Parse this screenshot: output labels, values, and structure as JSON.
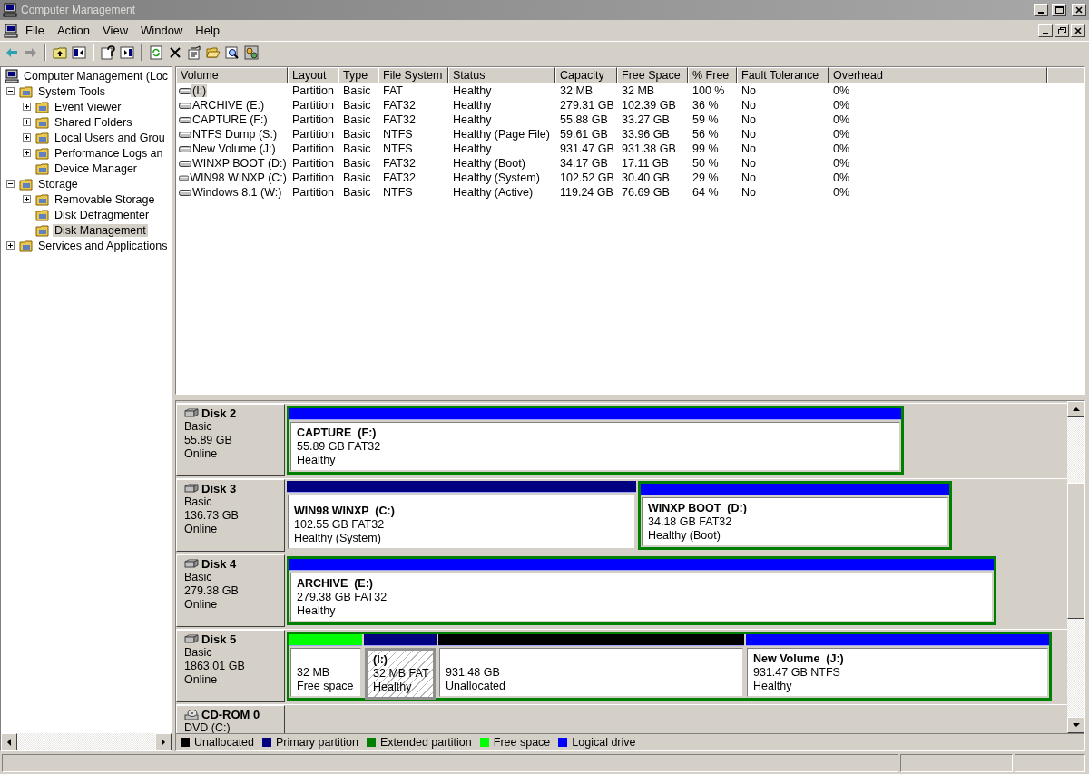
{
  "window": {
    "title": "Computer Management"
  },
  "menu": [
    "File",
    "Action",
    "View",
    "Window",
    "Help"
  ],
  "tree": [
    {
      "label": "Computer Management (Loc",
      "selected": false,
      "children": [
        {
          "label": "System Tools",
          "selected": false,
          "expanded": true,
          "children": [
            {
              "label": "Event Viewer",
              "selected": false,
              "expanded": false
            },
            {
              "label": "Shared Folders",
              "selected": false,
              "expanded": false
            },
            {
              "label": "Local Users and Grou",
              "selected": false,
              "expanded": false
            },
            {
              "label": "Performance Logs an",
              "selected": false,
              "expanded": false
            },
            {
              "label": "Device Manager",
              "selected": false
            }
          ]
        },
        {
          "label": "Storage",
          "selected": false,
          "expanded": true,
          "children": [
            {
              "label": "Removable Storage",
              "selected": false,
              "expanded": false
            },
            {
              "label": "Disk Defragmenter",
              "selected": false
            },
            {
              "label": "Disk Management",
              "selected": true
            }
          ]
        },
        {
          "label": "Services and Applications",
          "selected": false,
          "expanded": false
        }
      ]
    }
  ],
  "table": {
    "columns": [
      "Volume",
      "Layout",
      "Type",
      "File System",
      "Status",
      "Capacity",
      "Free Space",
      "% Free",
      "Fault Tolerance",
      "Overhead"
    ],
    "rows": [
      {
        "selected": true,
        "cells": [
          "(I:)",
          "Partition",
          "Basic",
          "FAT",
          "Healthy",
          "32 MB",
          "32 MB",
          "100 %",
          "No",
          "0%"
        ]
      },
      {
        "selected": false,
        "cells": [
          "ARCHIVE (E:)",
          "Partition",
          "Basic",
          "FAT32",
          "Healthy",
          "279.31 GB",
          "102.39 GB",
          "36 %",
          "No",
          "0%"
        ]
      },
      {
        "selected": false,
        "cells": [
          "CAPTURE (F:)",
          "Partition",
          "Basic",
          "FAT32",
          "Healthy",
          "55.88 GB",
          "33.27 GB",
          "59 %",
          "No",
          "0%"
        ]
      },
      {
        "selected": false,
        "cells": [
          "NTFS Dump (S:)",
          "Partition",
          "Basic",
          "NTFS",
          "Healthy (Page File)",
          "59.61 GB",
          "33.96 GB",
          "56 %",
          "No",
          "0%"
        ]
      },
      {
        "selected": false,
        "cells": [
          "New Volume (J:)",
          "Partition",
          "Basic",
          "NTFS",
          "Healthy",
          "931.47 GB",
          "931.38 GB",
          "99 %",
          "No",
          "0%"
        ]
      },
      {
        "selected": false,
        "cells": [
          "WINXP BOOT (D:)",
          "Partition",
          "Basic",
          "FAT32",
          "Healthy (Boot)",
          "34.17 GB",
          "17.11 GB",
          "50 %",
          "No",
          "0%"
        ]
      },
      {
        "selected": false,
        "cells": [
          "WIN98 WINXP (C:)",
          "Partition",
          "Basic",
          "FAT32",
          "Healthy (System)",
          "102.52 GB",
          "30.40 GB",
          "29 %",
          "No",
          "0%"
        ]
      },
      {
        "selected": false,
        "cells": [
          "Windows 8.1 (W:)",
          "Partition",
          "Basic",
          "NTFS",
          "Healthy (Active)",
          "119.24 GB",
          "76.69 GB",
          "64 %",
          "No",
          "0%"
        ]
      }
    ]
  },
  "disks": [
    {
      "kind": "disk",
      "name": "Disk 2",
      "type": "Basic",
      "size": "55.89 GB",
      "status": "Online",
      "partitions": [
        {
          "kind": "logical",
          "extended": true,
          "selected": false,
          "title": "CAPTURE  (F:)",
          "size": "55.89 GB FAT32",
          "status": "Healthy"
        }
      ]
    },
    {
      "kind": "disk",
      "name": "Disk 3",
      "type": "Basic",
      "size": "136.73 GB",
      "status": "Online",
      "partitions": [
        {
          "kind": "primary",
          "extended": false,
          "selected": false,
          "title": "WIN98 WINXP  (C:)",
          "size": "102.55 GB FAT32",
          "status": "Healthy (System)"
        },
        {
          "kind": "logical",
          "extended": true,
          "selected": false,
          "title": "WINXP BOOT  (D:)",
          "size": "34.18 GB FAT32",
          "status": "Healthy (Boot)"
        }
      ]
    },
    {
      "kind": "disk",
      "name": "Disk 4",
      "type": "Basic",
      "size": "279.38 GB",
      "status": "Online",
      "partitions": [
        {
          "kind": "logical",
          "extended": true,
          "selected": false,
          "title": "ARCHIVE  (E:)",
          "size": "279.38 GB FAT32",
          "status": "Healthy"
        }
      ]
    },
    {
      "kind": "disk",
      "name": "Disk 5",
      "type": "Basic",
      "size": "1863.01 GB",
      "status": "Online",
      "partitions": [
        {
          "kind": "free",
          "extended": true,
          "selected": false,
          "size": "32 MB",
          "status": "Free space"
        },
        {
          "kind": "primary",
          "extended": true,
          "selected": true,
          "title": "(I:)",
          "size": "32 MB FAT",
          "status": "Healthy"
        },
        {
          "kind": "unallocated",
          "extended": true,
          "selected": false,
          "size": "931.48 GB",
          "status": "Unallocated"
        },
        {
          "kind": "logical",
          "extended": true,
          "selected": false,
          "title": "New Volume  (J:)",
          "size": "931.47 GB NTFS",
          "status": "Healthy"
        }
      ]
    },
    {
      "kind": "cdrom",
      "name": "CD-ROM 0",
      "type": "DVD (C:)"
    }
  ],
  "legend": [
    {
      "label": "Unallocated",
      "color": "#000000"
    },
    {
      "label": "Primary partition",
      "color": "#000080"
    },
    {
      "label": "Extended partition",
      "color": "#008000"
    },
    {
      "label": "Free space",
      "color": "#00ff00"
    },
    {
      "label": "Logical drive",
      "color": "#0000ff"
    }
  ]
}
